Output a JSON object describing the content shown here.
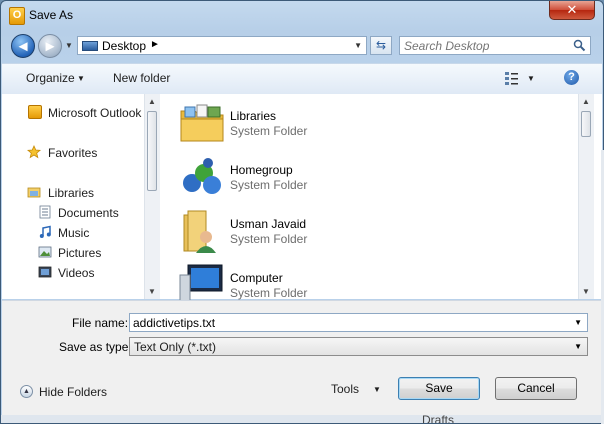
{
  "window": {
    "title": "Save As",
    "close_symbol": "✕"
  },
  "address_bar": {
    "location": "Desktop"
  },
  "search": {
    "placeholder": "Search Desktop"
  },
  "toolbar": {
    "organize_label": "Organize",
    "new_folder_label": "New folder",
    "help_symbol": "?"
  },
  "nav_pane": {
    "items": [
      {
        "label": "Microsoft Outlook",
        "icon": "outlook-icon"
      },
      {
        "label": "Favorites",
        "icon": "star-icon"
      },
      {
        "label": "Libraries",
        "icon": "libraries-icon"
      },
      {
        "label": "Documents",
        "icon": "documents-icon"
      },
      {
        "label": "Music",
        "icon": "music-icon"
      },
      {
        "label": "Pictures",
        "icon": "pictures-icon"
      },
      {
        "label": "Videos",
        "icon": "videos-icon"
      }
    ]
  },
  "files": [
    {
      "name": "Libraries",
      "type": "System Folder",
      "icon": "libraries-folder-icon"
    },
    {
      "name": "Homegroup",
      "type": "System Folder",
      "icon": "homegroup-icon"
    },
    {
      "name": "Usman Javaid",
      "type": "System Folder",
      "icon": "user-folder-icon"
    },
    {
      "name": "Computer",
      "type": "System Folder",
      "icon": "computer-icon"
    }
  ],
  "form": {
    "file_name_label": "File name:",
    "file_name_value": "addictivetips.txt",
    "save_type_label": "Save as type:",
    "save_type_value": "Text Only (*.txt)"
  },
  "footer": {
    "hide_folders_label": "Hide Folders",
    "tools_label": "Tools",
    "save_label": "Save",
    "cancel_label": "Cancel"
  },
  "background": {
    "peek_text": "Drafts"
  },
  "colors": {
    "accent": "#2565b9",
    "title_bar": "#c4d9ee",
    "close": "#cf4d38"
  }
}
